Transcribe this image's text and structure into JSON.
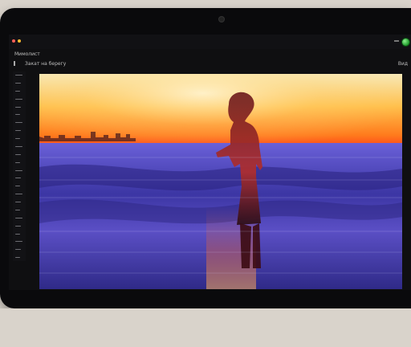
{
  "window": {
    "app_title": "Мимолист",
    "breadcrumb": "Закат на берегу",
    "toolbar_right": "Вид"
  },
  "colors": {
    "sky_top": "#f7e9b9",
    "sky_mid": "#ff9c2a",
    "horizon": "#ff5a1a",
    "sea_deep": "#2f2a88",
    "sea_light": "#6a60d8",
    "silhouette": "#7a2a2a",
    "traffic_red": "#ff5f57",
    "traffic_yellow": "#febc2e",
    "traffic_green": "#28c840"
  },
  "icons": {
    "status": "green-status-icon",
    "sidebar_handle": "sidebar-handle-icon"
  },
  "sidebar": {
    "items_count_visible": 24
  }
}
